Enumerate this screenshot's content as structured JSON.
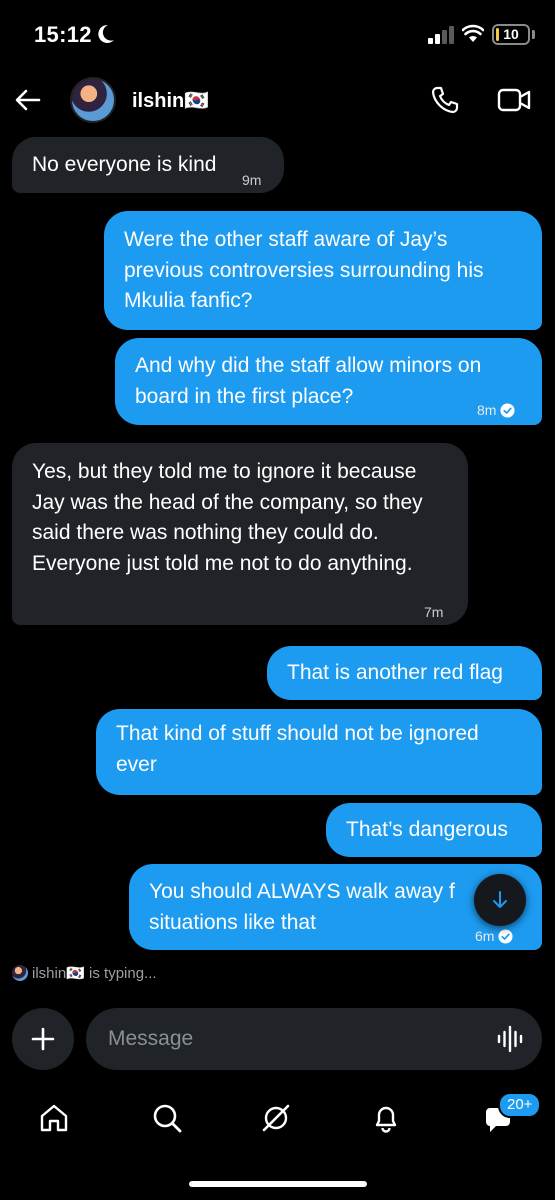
{
  "status": {
    "time": "15:12",
    "battery": "10",
    "battery_level": 0.1
  },
  "header": {
    "name": "ilshin🇰🇷"
  },
  "messages": [
    {
      "from": "them",
      "text": "No everyone is kind",
      "time": "9m"
    },
    {
      "from": "me",
      "text": "Were the other staff aware of Jay’s previous controversies surrounding his Mkulia fanfic?",
      "time": ""
    },
    {
      "from": "me",
      "text": "And why did the staff allow minors on board in the first place?",
      "time": "8m"
    },
    {
      "from": "them",
      "text": "Yes, but they told me to ignore it because Jay was the head of the company, so they said there was nothing they could do. Everyone just told me not to do anything.",
      "time": "7m"
    },
    {
      "from": "me",
      "text": "That is another red flag",
      "time": ""
    },
    {
      "from": "me",
      "text": "That kind of stuff should not be ignored ever",
      "time": ""
    },
    {
      "from": "me",
      "text": "That’s dangerous",
      "time": ""
    },
    {
      "from": "me",
      "text": "You should ALWAYS walk away f situations like that",
      "time": "6m"
    }
  ],
  "typing": "ilshin🇰🇷 is typing...",
  "composer": {
    "placeholder": "Message"
  },
  "nav": {
    "badge": "20+"
  },
  "colors": {
    "accent": "#1d9bf0",
    "incoming": "#202327",
    "background": "#000000"
  },
  "icons": [
    "back-icon",
    "phone-icon",
    "video-icon",
    "check-icon",
    "arrow-down-icon",
    "plus-icon",
    "voice-icon",
    "home-icon",
    "search-icon",
    "grok-icon",
    "bell-icon",
    "messages-icon"
  ]
}
